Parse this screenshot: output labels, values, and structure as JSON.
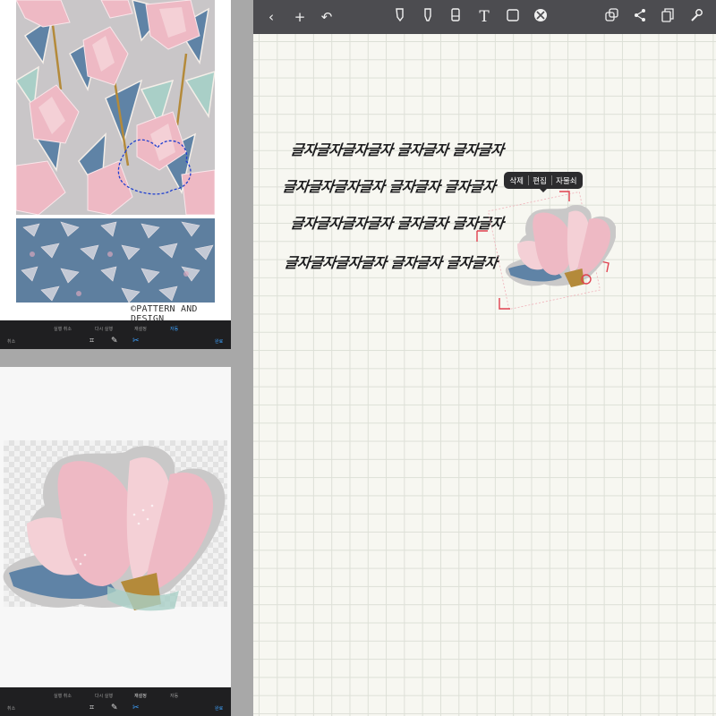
{
  "left_top_panel": {
    "watermark": "©PATTERN AND DESIGN",
    "toolbar": {
      "left": "취소",
      "undo": "실행 취소",
      "redo": "다시 실행",
      "reset": "재설정",
      "done_tab": "자동",
      "confirm": "완료"
    }
  },
  "left_bottom_panel": {
    "toolbar": {
      "left": "취소",
      "undo": "실행 취소",
      "redo": "다시 실행",
      "reset": "재설정",
      "done_tab": "자동",
      "confirm": "완료"
    }
  },
  "app": {
    "toolbar_icons": [
      "back-icon",
      "add-icon",
      "undo-icon",
      "pen-icon",
      "highlighter-icon",
      "eraser-icon",
      "text-icon",
      "shape-icon",
      "lasso-icon",
      "layers-icon",
      "share-icon",
      "pages-icon",
      "settings-icon"
    ],
    "handwriting_lines": [
      "글자글자글자글자 글자글자 글자글자",
      "글자글자글자글자 글자글자 글자글자",
      "글자글자글자글자 글자글자 글자글자",
      "글자글자글자글자 글자글자 글자글자"
    ],
    "context_menu": {
      "delete": "삭제",
      "edit": "편집",
      "magnet": "자물쇠"
    }
  },
  "colors": {
    "pink": "#eeb9c4",
    "pink_light": "#f4d0d6",
    "blue": "#5f83a6",
    "mint": "#a9cfc7",
    "selection_red": "#e0414f",
    "toolbar_gray": "#4c4c50"
  }
}
